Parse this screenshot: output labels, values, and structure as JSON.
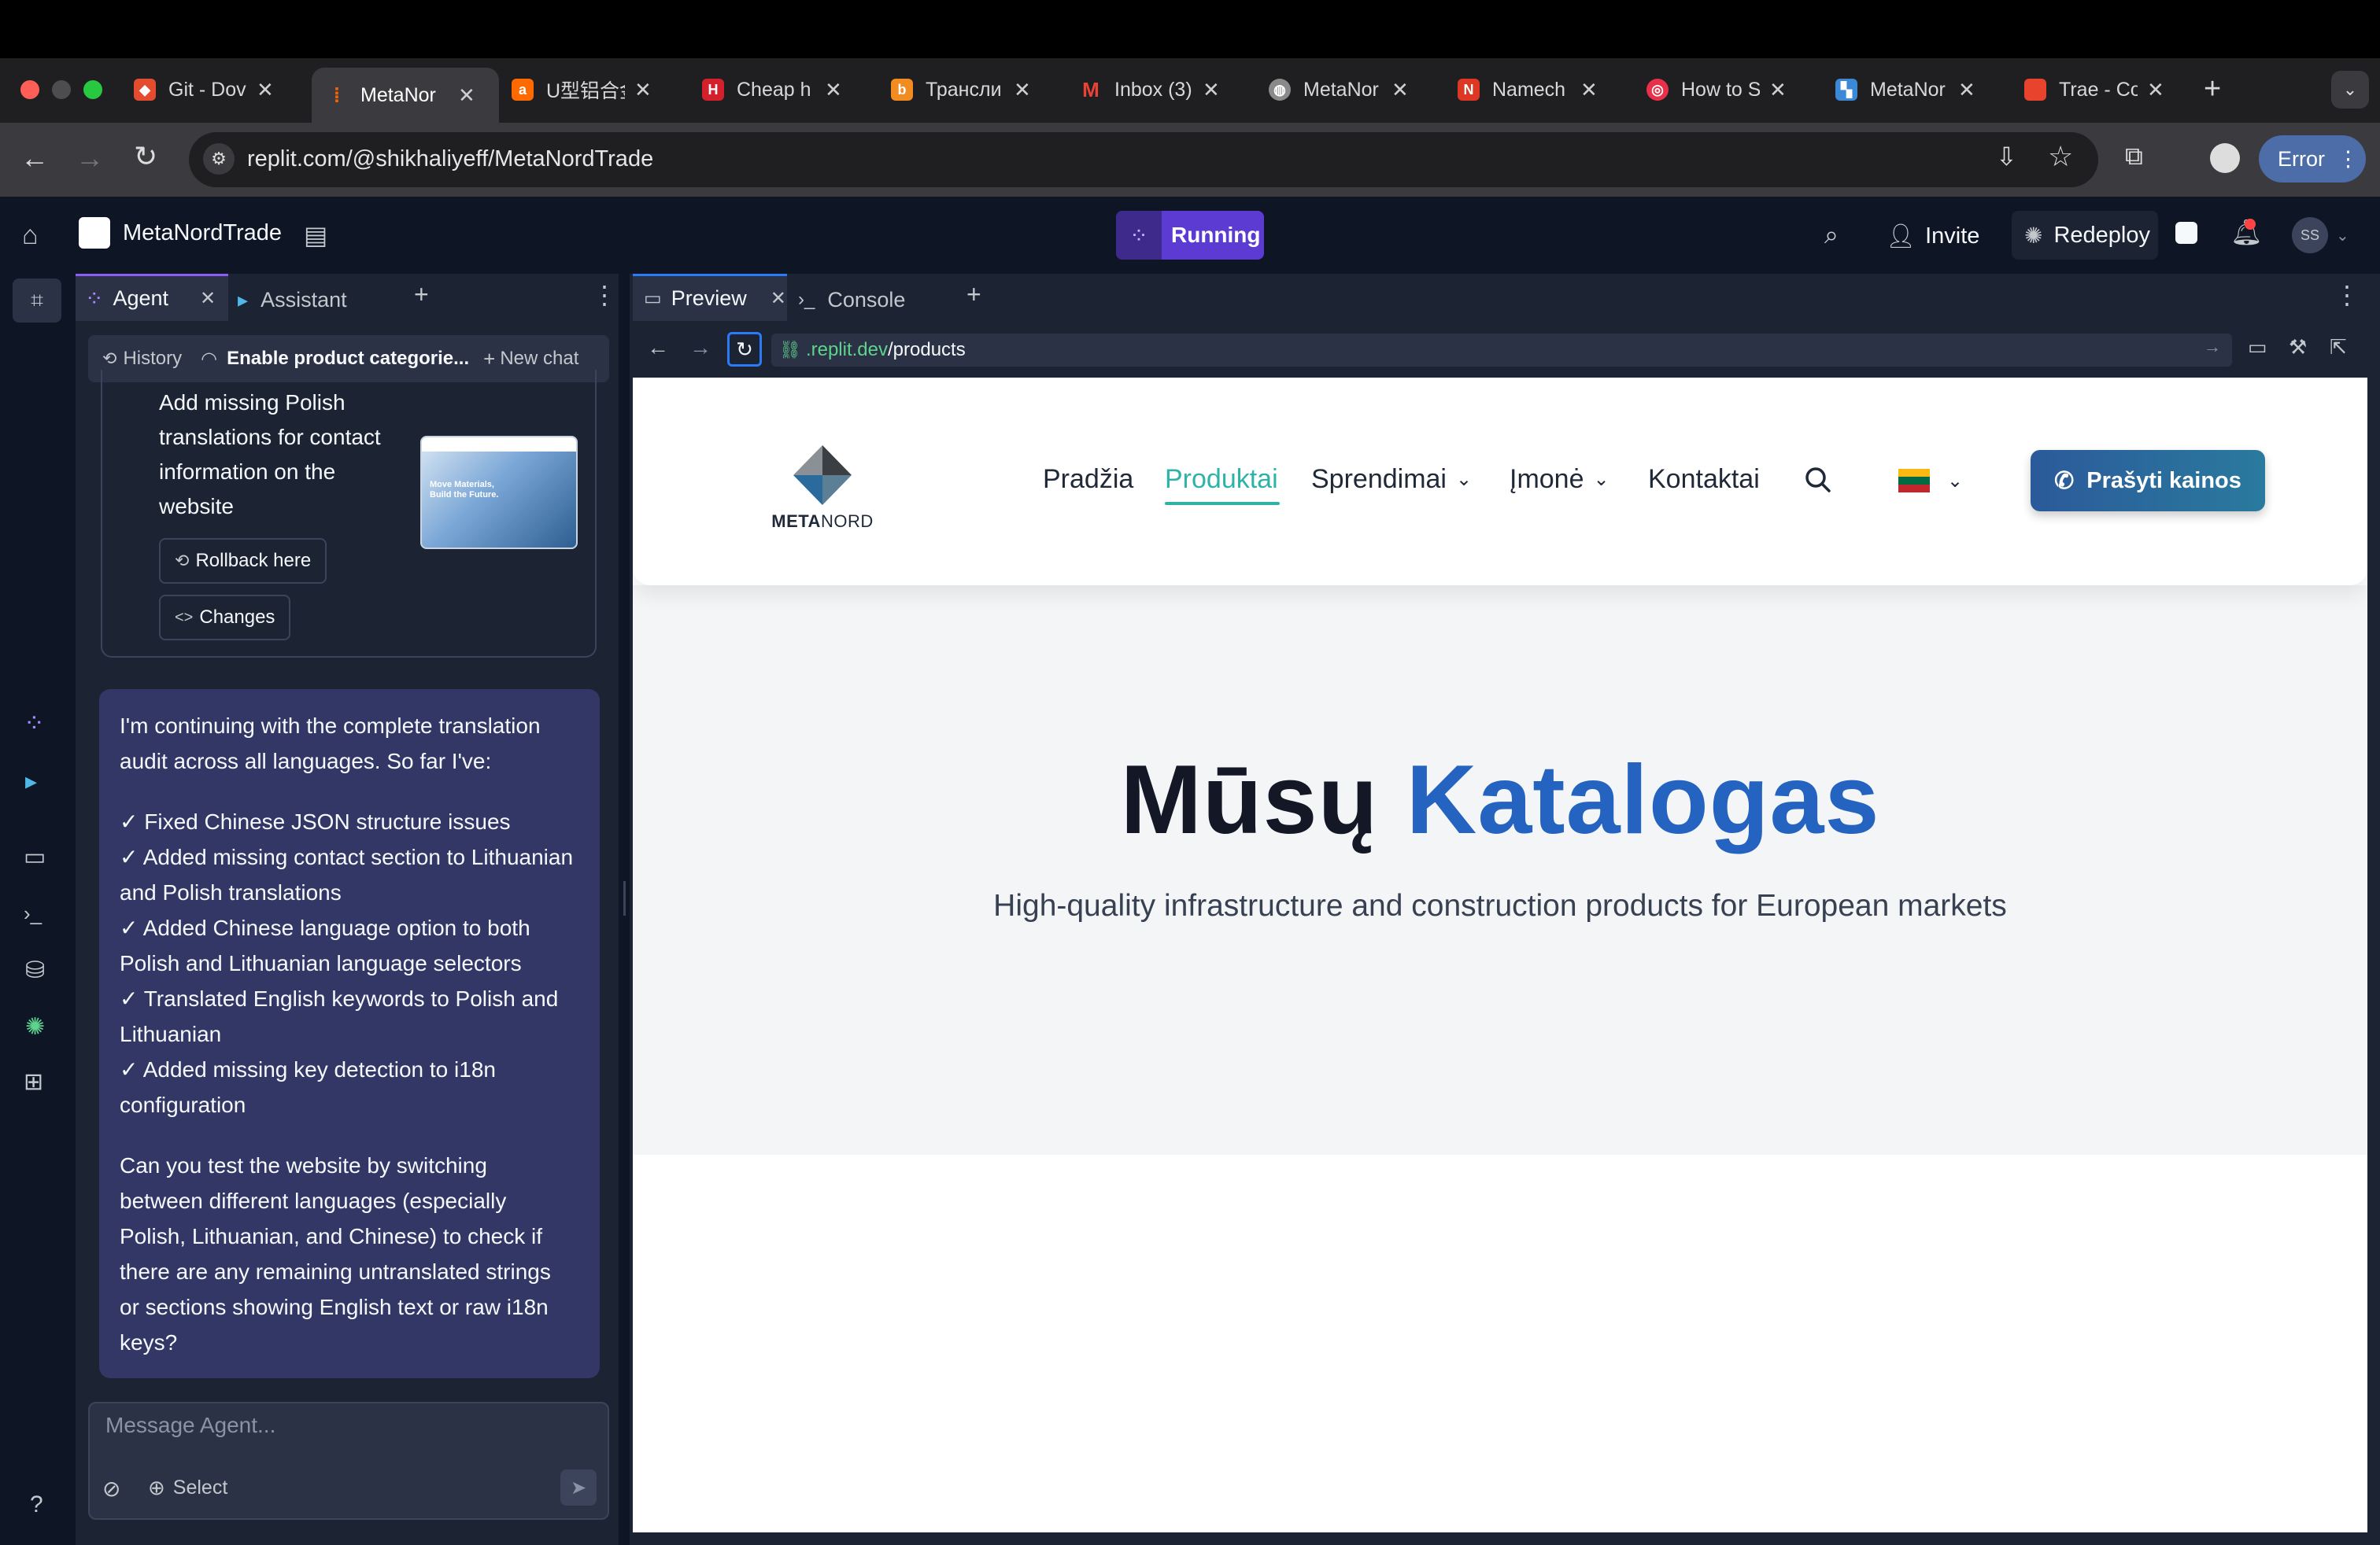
{
  "browser": {
    "tabs": [
      {
        "title": "Git - Dov",
        "favicon": "git-icon",
        "color": "#e44c30"
      },
      {
        "title": "MetaNor",
        "favicon": "replit-icon",
        "color": "#f26207",
        "active": true
      },
      {
        "title": "U型铝合金",
        "favicon": "alibaba-icon",
        "color": "#ff6a00"
      },
      {
        "title": "Cheap h",
        "favicon": "h-icon",
        "color": "#d4202b"
      },
      {
        "title": "Трансли",
        "favicon": "translit-icon",
        "color": "#f28b20"
      },
      {
        "title": "Inbox (3)",
        "favicon": "gmail-icon",
        "color": "#ea4335"
      },
      {
        "title": "MetaNor",
        "favicon": "globe-icon",
        "color": "#8a8a8a"
      },
      {
        "title": "Namech",
        "favicon": "namecheap-icon",
        "color": "#de3723"
      },
      {
        "title": "How to S",
        "favicon": "target-icon",
        "color": "#e8304a"
      },
      {
        "title": "MetaNor",
        "favicon": "metanord-icon",
        "color": "#3a88d6"
      },
      {
        "title": "Trae - Co",
        "favicon": "trae-icon",
        "color": "#e8432d"
      }
    ],
    "url": "replit.com/@shikhaliyeff/MetaNordTrade",
    "error_label": "Error"
  },
  "replit": {
    "project_name": "MetaNordTrade",
    "running_label": "Running",
    "invite_label": "Invite",
    "redeploy_label": "Redeploy",
    "avatar_initials": "SS",
    "agent_tabs": {
      "agent": "Agent",
      "assistant": "Assistant"
    },
    "history_label": "History",
    "chat_title": "Enable product categorie...",
    "new_chat_label": "New chat",
    "checkpoint": {
      "lines": [
        "Add missing Polish",
        "translations for contact",
        "information on the",
        "website"
      ],
      "rollback_label": "Rollback here",
      "changes_label": "Changes",
      "thumb_text": "Move Materials, Build the Future."
    },
    "message": {
      "intro": [
        "I'm continuing with the complete translation",
        "audit across all languages. So far I've:"
      ],
      "items": [
        [
          "✓ Fixed Chinese JSON structure issues"
        ],
        [
          "✓ Added missing contact section to Lithuanian",
          "and Polish translations"
        ],
        [
          "✓ Added Chinese language option to both",
          "Polish and Lithuanian language selectors"
        ],
        [
          "✓ Translated English keywords to Polish and",
          "Lithuanian"
        ],
        [
          "✓ Added missing key detection to i18n",
          "configuration"
        ]
      ],
      "outro": [
        "Can you test the website by switching",
        "between different languages (especially",
        "Polish, Lithuanian, and Chinese) to check if",
        "there are any remaining untranslated strings",
        "or sections showing English text or raw i18n",
        "keys?"
      ]
    },
    "input_placeholder": "Message Agent...",
    "select_label": "Select",
    "preview_tabs": {
      "preview": "Preview",
      "console": "Console"
    },
    "preview_url_domain": ".replit.dev",
    "preview_url_path": "/products",
    "help_label": "?"
  },
  "site": {
    "logo_meta": "META",
    "logo_nord": "NORD",
    "nav": [
      "Pradžia",
      "Produktai",
      "Sprendimai",
      "Įmonė",
      "Kontaktai"
    ],
    "cta": "Prašyti kainos",
    "hero_title_1": "Mūsų",
    "hero_title_2": "Katalogas",
    "hero_subtitle": "High-quality infrastructure and construction products for European markets",
    "colors": {
      "accent": "#2563c0",
      "active_nav": "#2fb3a8",
      "cta": "#2b6a9c"
    }
  }
}
